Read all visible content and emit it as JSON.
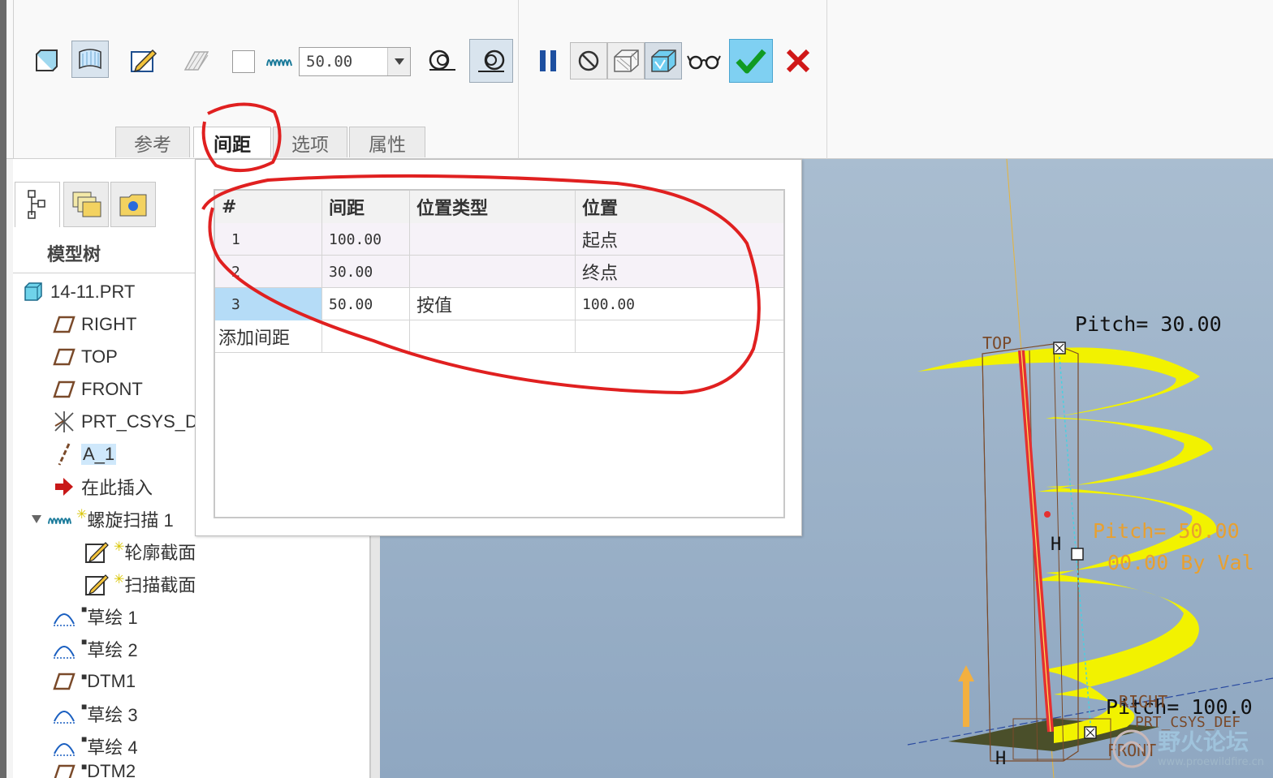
{
  "toolbar": {
    "pitch_value": "50.00",
    "tabs": [
      {
        "label": "参考"
      },
      {
        "label": "间距"
      },
      {
        "label": "选项"
      },
      {
        "label": "属性"
      }
    ]
  },
  "pitch_table": {
    "headers": [
      "#",
      "间距",
      "位置类型",
      "位置"
    ],
    "rows": [
      {
        "num": "1",
        "pitch": "100.00",
        "type": "",
        "location": "起点"
      },
      {
        "num": "2",
        "pitch": "30.00",
        "type": "",
        "location": "终点"
      },
      {
        "num": "3",
        "pitch": "50.00",
        "type": "按值",
        "location": "100.00"
      }
    ],
    "add_label": "添加间距"
  },
  "model_tree": {
    "title": "模型树",
    "items": [
      {
        "label": "14-11.PRT",
        "icon": "part-icon"
      },
      {
        "label": "RIGHT",
        "icon": "datum-plane-icon"
      },
      {
        "label": "TOP",
        "icon": "datum-plane-icon"
      },
      {
        "label": "FRONT",
        "icon": "datum-plane-icon"
      },
      {
        "label": "PRT_CSYS_D",
        "icon": "csys-icon"
      },
      {
        "label": "A_1",
        "icon": "datum-axis-icon"
      },
      {
        "label": "在此插入",
        "icon": "insert-arrow-icon"
      },
      {
        "label": "螺旋扫描 1",
        "icon": "helical-sweep-icon"
      },
      {
        "label": "轮廓截面",
        "icon": "sketch-edit-icon"
      },
      {
        "label": "扫描截面",
        "icon": "sketch-edit-icon"
      },
      {
        "label": "草绘 1",
        "icon": "sketch-icon"
      },
      {
        "label": "草绘 2",
        "icon": "sketch-icon"
      },
      {
        "label": "DTM1",
        "icon": "datum-plane-icon"
      },
      {
        "label": "草绘 3",
        "icon": "sketch-icon"
      },
      {
        "label": "草绘 4",
        "icon": "sketch-icon"
      },
      {
        "label": "DTM2",
        "icon": "datum-plane-icon"
      }
    ]
  },
  "viewport": {
    "labels": {
      "pitch_top": "Pitch= 30.00",
      "pitch_mid": "Pitch= 50.00",
      "pitch_mid_sub": "00.00 By Val",
      "pitch_bottom": "Pitch= 100.0",
      "top": "TOP",
      "right": "RIGHT",
      "front": "FRONT",
      "csys": "PRT_CSYS_DEF",
      "h1": "H",
      "h2": "H"
    },
    "watermark": "野火论坛",
    "watermark_url": "www.proewildfire.cn"
  },
  "colors": {
    "accent_blue": "#1f5fb0",
    "confirm_green": "#1a9a2a",
    "cancel_red": "#d01818",
    "annotation_red": "#e02020",
    "helix_yellow": "#f2f200"
  }
}
